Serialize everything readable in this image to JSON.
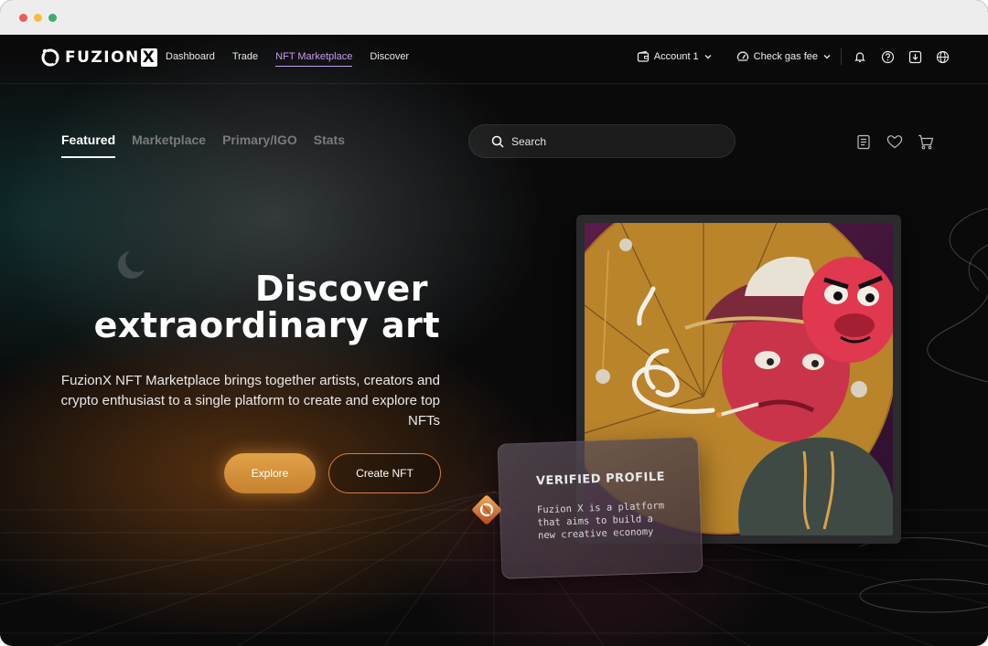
{
  "window": {
    "traffic_lights": [
      "#ee5c56",
      "#f5be3e",
      "#3cae6a"
    ]
  },
  "brand": {
    "logo_text": "FUZION",
    "logo_x": "X"
  },
  "nav": {
    "links": [
      {
        "label": "Dashboard",
        "active": false
      },
      {
        "label": "Trade",
        "active": false
      },
      {
        "label": "NFT Marketplace",
        "active": true
      },
      {
        "label": "Discover",
        "active": false
      }
    ],
    "account_label": "Account 1",
    "gas_label": "Check gas fee",
    "icons": [
      "wallet-icon",
      "gauge-icon",
      "bell-icon",
      "help-icon",
      "download-icon",
      "globe-icon"
    ]
  },
  "subtabs": [
    {
      "label": "Featured",
      "active": true
    },
    {
      "label": "Marketplace",
      "active": false
    },
    {
      "label": "Primary/IGO",
      "active": false
    },
    {
      "label": "Stats",
      "active": false
    }
  ],
  "search": {
    "placeholder": "Search"
  },
  "tools": [
    "list-icon",
    "heart-icon",
    "cart-icon"
  ],
  "hero": {
    "title_line1": "Discover",
    "title_line2": "extraordinary art",
    "description": "FuzionX NFT Marketplace brings together artists, creators and crypto enthusiast to a single platform to create and explore top NFTs",
    "explore_label": "Explore",
    "create_label": "Create NFT"
  },
  "verified_card": {
    "title": "VERIFIED PROFILE",
    "body": "Fuzion X is a platform that aims to build a new creative economy"
  },
  "colors": {
    "accent_orange": "#d8923f",
    "nav_active": "#c79cf0"
  }
}
